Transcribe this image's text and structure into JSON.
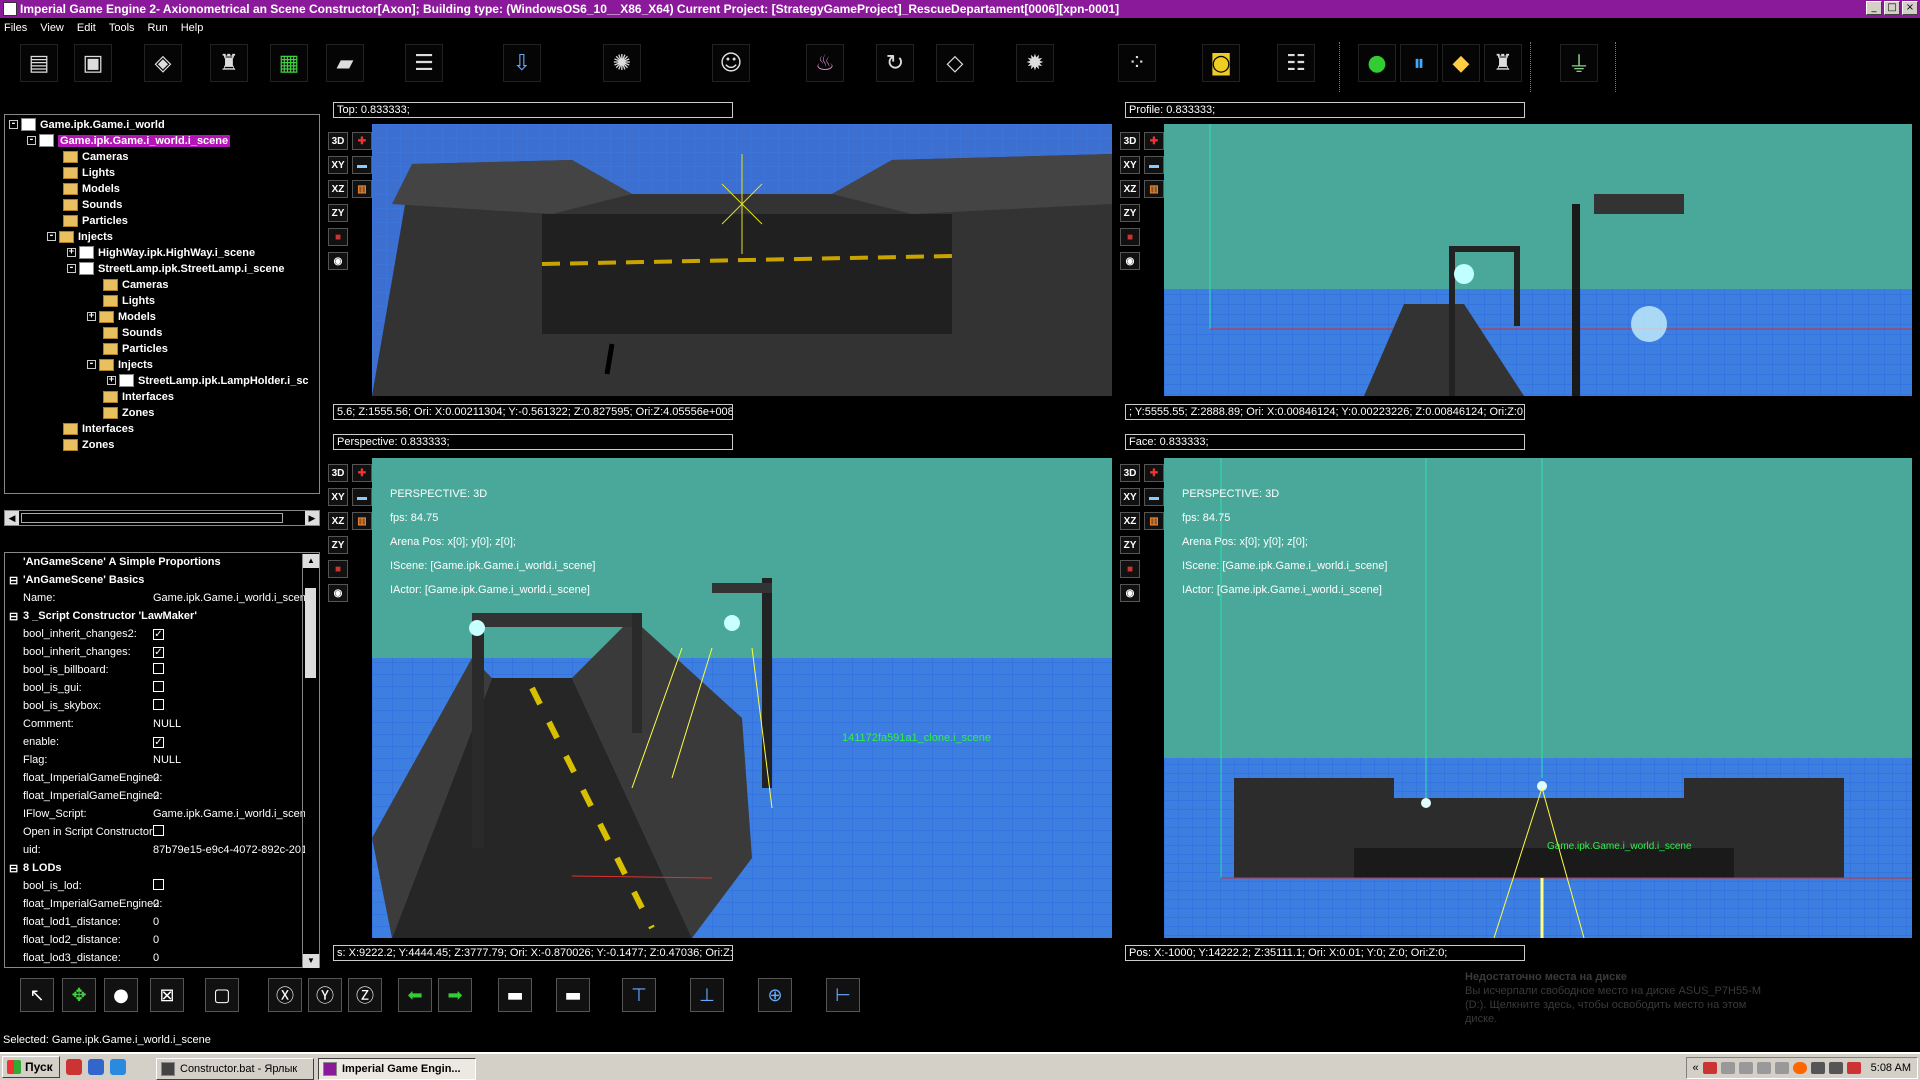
{
  "window": {
    "title": "Imperial Game Engine 2- Axionometrical an Scene Constructor[Axon]; Building type: (WindowsOS6_10__X86_X64) Current Project: [StrategyGameProject]_RescueDepartament[0006][xpn-0001]",
    "controls": [
      "_",
      "□",
      "×"
    ]
  },
  "menu": [
    "Files",
    "View",
    "Edit",
    "Tools",
    "Run",
    "Help"
  ],
  "toolbar_icons": [
    "open-folder-icon",
    "save-icon",
    "cube-icon",
    "eagle-emblem-icon",
    "chart-icon",
    "clapperboard-icon",
    "layers-icon",
    "import-icon",
    "atom-icon",
    "theater-mask-icon",
    "cake-icon",
    "loop-icon",
    "diamond-icon",
    "gear-network-icon",
    "particles-icon",
    "barrel-icon",
    "sliders-icon",
    "run-icon",
    "pause-icon",
    "layers-stack-icon",
    "eagle-emblem-icon",
    "plug-icon"
  ],
  "scene_tree": [
    {
      "label": "Game.ipk.Game.i_world",
      "icon": "doc",
      "exp": "-"
    },
    {
      "label": "Game.ipk.Game.i_world.i_scene",
      "icon": "doc",
      "exp": "-",
      "selected": true
    },
    {
      "label": "Cameras",
      "icon": "folder"
    },
    {
      "label": "Lights",
      "icon": "folder"
    },
    {
      "label": "Models",
      "icon": "folder"
    },
    {
      "label": "Sounds",
      "icon": "folder"
    },
    {
      "label": "Particles",
      "icon": "folder"
    },
    {
      "label": "Injects",
      "icon": "folder",
      "exp": "-"
    },
    {
      "label": "HighWay.ipk.HighWay.i_scene",
      "icon": "doc",
      "exp": "+"
    },
    {
      "label": "StreetLamp.ipk.StreetLamp.i_scene",
      "icon": "doc",
      "exp": "-"
    },
    {
      "label": "Cameras",
      "icon": "folder"
    },
    {
      "label": "Lights",
      "icon": "folder"
    },
    {
      "label": "Models",
      "icon": "folder",
      "exp": "+"
    },
    {
      "label": "Sounds",
      "icon": "folder"
    },
    {
      "label": "Particles",
      "icon": "folder"
    },
    {
      "label": "Injects",
      "icon": "folder",
      "exp": "-"
    },
    {
      "label": "StreetLamp.ipk.LampHolder.i_sc",
      "icon": "doc",
      "exp": "+"
    },
    {
      "label": "Interfaces",
      "icon": "folder"
    },
    {
      "label": "Zones",
      "icon": "folder"
    },
    {
      "label": "Interfaces",
      "icon": "folder"
    },
    {
      "label": "Zones",
      "icon": "folder"
    }
  ],
  "properties": [
    {
      "type": "header",
      "name": "'AnGameScene' A Simple Proportions"
    },
    {
      "type": "section",
      "name": "'AnGameScene' Basics"
    },
    {
      "type": "text",
      "name": "Name:",
      "value": "Game.ipk.Game.i_world.i_scene"
    },
    {
      "type": "section",
      "name": "3 _Script Constructor 'LawMaker'"
    },
    {
      "type": "check",
      "name": "bool_inherit_changes2:",
      "checked": true
    },
    {
      "type": "check",
      "name": "bool_inherit_changes:",
      "checked": true
    },
    {
      "type": "check",
      "name": "bool_is_billboard:",
      "checked": false
    },
    {
      "type": "check",
      "name": "bool_is_gui:",
      "checked": false
    },
    {
      "type": "check",
      "name": "bool_is_skybox:",
      "checked": false
    },
    {
      "type": "text",
      "name": "Comment:",
      "value": "NULL"
    },
    {
      "type": "check",
      "name": "enable:",
      "checked": true
    },
    {
      "type": "text",
      "name": "Flag:",
      "value": "NULL"
    },
    {
      "type": "text",
      "name": "float_ImperialGameEngine2:",
      "value": "0"
    },
    {
      "type": "text",
      "name": "float_ImperialGameEngine2:",
      "value": "0"
    },
    {
      "type": "text",
      "name": "IFlow_Script:",
      "value": "Game.ipk.Game.i_world.i_scene"
    },
    {
      "type": "check",
      "name": "Open in Script Constructor:",
      "checked": false
    },
    {
      "type": "text",
      "name": "uid:",
      "value": "87b79e15-e9c4-4072-892c-201"
    },
    {
      "type": "section",
      "name": "8 LODs"
    },
    {
      "type": "check",
      "name": "bool_is_lod:",
      "checked": false
    },
    {
      "type": "text",
      "name": "float_ImperialGameEngine2:",
      "value": "0"
    },
    {
      "type": "text",
      "name": "float_lod1_distance:",
      "value": "0"
    },
    {
      "type": "text",
      "name": "float_lod2_distance:",
      "value": "0"
    },
    {
      "type": "text",
      "name": "float_lod3_distance:",
      "value": "0"
    }
  ],
  "viewports": {
    "top": {
      "label": "Top: 0.833333;",
      "coords": "5.6; Z:1555.56; Ori: X:0.00211304; Y:-0.561322; Z:0.827595; Ori:Z:4.05556e+008;"
    },
    "profile": {
      "label": "Profile: 0.833333;",
      "coords": "; Y:5555.55; Z:2888.89; Ori: X:0.00846124; Y:0.00223226; Z:0.00846124; Ori:Z:0;"
    },
    "perspective": {
      "label": "Perspective: 0.833333;",
      "coords": "s: X:9222.2; Y:4444.45; Z:3777.79; Ori: X:-0.870026; Y:-0.1477; Z:0.47036; Ori:Z:0;",
      "overlay": [
        "PERSPECTIVE: 3D",
        "fps: 84.75",
        "Arena Pos: x[0]; y[0]; z[0];",
        "IScene: [Game.ipk.Game.i_world.i_scene]",
        "IActor: [Game.ipk.Game.i_world.i_scene]"
      ],
      "object_label": "141172fa591a1_clone.i_scene"
    },
    "face": {
      "label": "Face: 0.833333;",
      "coords": "Pos: X:-1000; Y:14222.2; Z:35111.1; Ori: X:0.01; Y:0; Z:0; Ori:Z:0;",
      "overlay": [
        "PERSPECTIVE: 3D",
        "fps: 84.75",
        "Arena Pos: x[0]; y[0]; z[0];",
        "IScene: [Game.ipk.Game.i_world.i_scene]",
        "IActor: [Game.ipk.Game.i_world.i_scene]"
      ],
      "object_label": "Game.ipk.Game.i_world.i_scene"
    }
  },
  "viewport_tools": [
    "3D",
    "+",
    "XY",
    "—",
    "XZ",
    "|||",
    "ZY",
    "■",
    "eye"
  ],
  "bottom_tools": [
    "select-arrow-icon",
    "move-axes-icon",
    "sphere-icon",
    "scale-icon",
    "square-icon",
    "x-axis-icon",
    "y-axis-icon",
    "z-axis-icon",
    "undo-arrow-icon",
    "redo-arrow-icon",
    "folder-add-icon",
    "folder-remove-icon",
    "align-top-icon",
    "align-bottom-icon",
    "align-center-icon",
    "align-middle-icon"
  ],
  "status": "Selected: Game.ipk.Game.i_world.i_scene",
  "notification": {
    "title": "Недостаточно места на диске",
    "body": "Вы исчерпали свободное место на диске ASUS_P7H55-M (D:). Щелкните здесь, чтобы освободить место на этом диске."
  },
  "taskbar": {
    "start": "Пуск",
    "tasks": [
      "Constructor.bat - Ярлык",
      "Imperial Game Engin..."
    ],
    "clock": "5:08 AM"
  },
  "colors": {
    "titlebar": "#8b1a9b",
    "selection": "#b415b8",
    "viewport_bg": "#49a89a",
    "grid": "#3a78e0"
  }
}
